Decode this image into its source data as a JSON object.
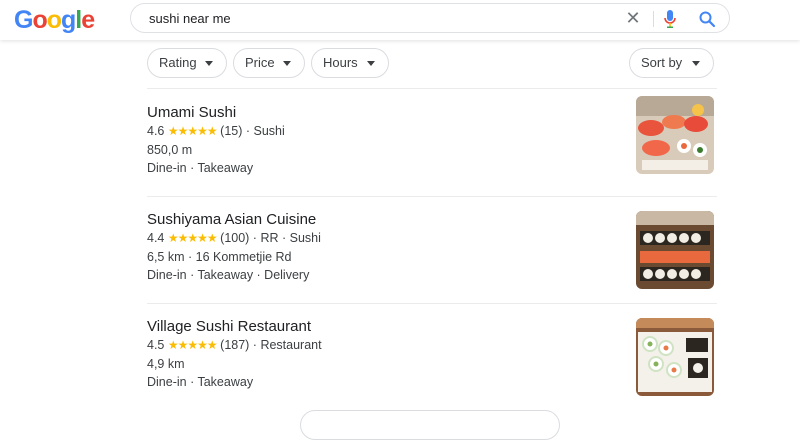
{
  "header": {
    "logo_letters": [
      "G",
      "o",
      "o",
      "g",
      "l",
      "e"
    ],
    "logo_colors": [
      "#4285F4",
      "#EA4335",
      "#FBBC05",
      "#4285F4",
      "#34A853",
      "#EA4335"
    ],
    "search": {
      "value": "sushi near me"
    },
    "icons": {
      "clear": "close-icon",
      "mic": "mic-icon",
      "search": "search-icon"
    }
  },
  "filters": {
    "rating": "Rating",
    "price": "Price",
    "hours": "Hours",
    "sort": "Sort by"
  },
  "results": [
    {
      "name": "Umami Sushi",
      "rating": "4.6",
      "stars": "★★★★★",
      "details": "(15) · Sushi",
      "line2": "850,0 m",
      "line3": "Dine-in · Takeaway"
    },
    {
      "name": "Sushiyama Asian Cuisine",
      "rating": "4.4",
      "stars": "★★★★★",
      "details": "(100) · RR · Sushi",
      "line2": "6,5 km · 16 Kommetjie Rd",
      "line3": "Dine-in · Takeaway · Delivery"
    },
    {
      "name": "Village Sushi Restaurant",
      "rating": "4.5",
      "stars": "★★★★★",
      "details": "(187) · Restaurant",
      "line2": "4,9 km",
      "line3": "Dine-in · Takeaway"
    }
  ],
  "colors": {
    "star": "#fbbc04",
    "accent": "#4285F4"
  }
}
